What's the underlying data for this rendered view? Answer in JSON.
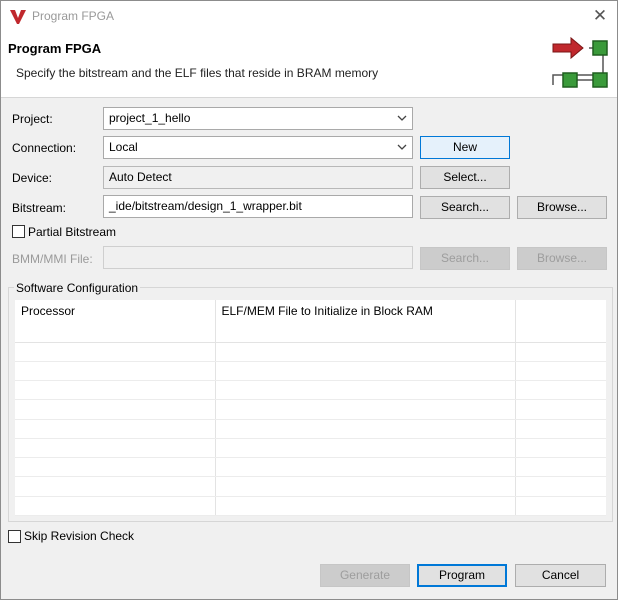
{
  "window": {
    "title": "Program FPGA"
  },
  "header": {
    "title": "Program FPGA",
    "description": "Specify the bitstream and the ELF files that reside in BRAM memory"
  },
  "form": {
    "project": {
      "label": "Project:",
      "value": "project_1_hello"
    },
    "connection": {
      "label": "Connection:",
      "value": "Local",
      "new_button": "New"
    },
    "device": {
      "label": "Device:",
      "value": "Auto Detect",
      "select_button": "Select..."
    },
    "bitstream": {
      "label": "Bitstream:",
      "value": "_ide/bitstream/design_1_wrapper.bit",
      "search_button": "Search...",
      "browse_button": "Browse..."
    },
    "partial_bitstream": {
      "label": "Partial Bitstream",
      "checked": false
    },
    "bmm_mmi": {
      "label": "BMM/MMI File:",
      "value": "",
      "search_button": "Search...",
      "browse_button": "Browse..."
    }
  },
  "software_config": {
    "label": "Software Configuration",
    "columns": [
      "Processor",
      "ELF/MEM File to Initialize in Block RAM",
      ""
    ]
  },
  "skip_revision": {
    "label": "Skip Revision Check",
    "checked": false
  },
  "footer": {
    "generate": "Generate",
    "program": "Program",
    "cancel": "Cancel"
  },
  "colors": {
    "accent": "#0078d7",
    "brand_red": "#c0282d",
    "graphic_green": "#3a9a3a"
  }
}
